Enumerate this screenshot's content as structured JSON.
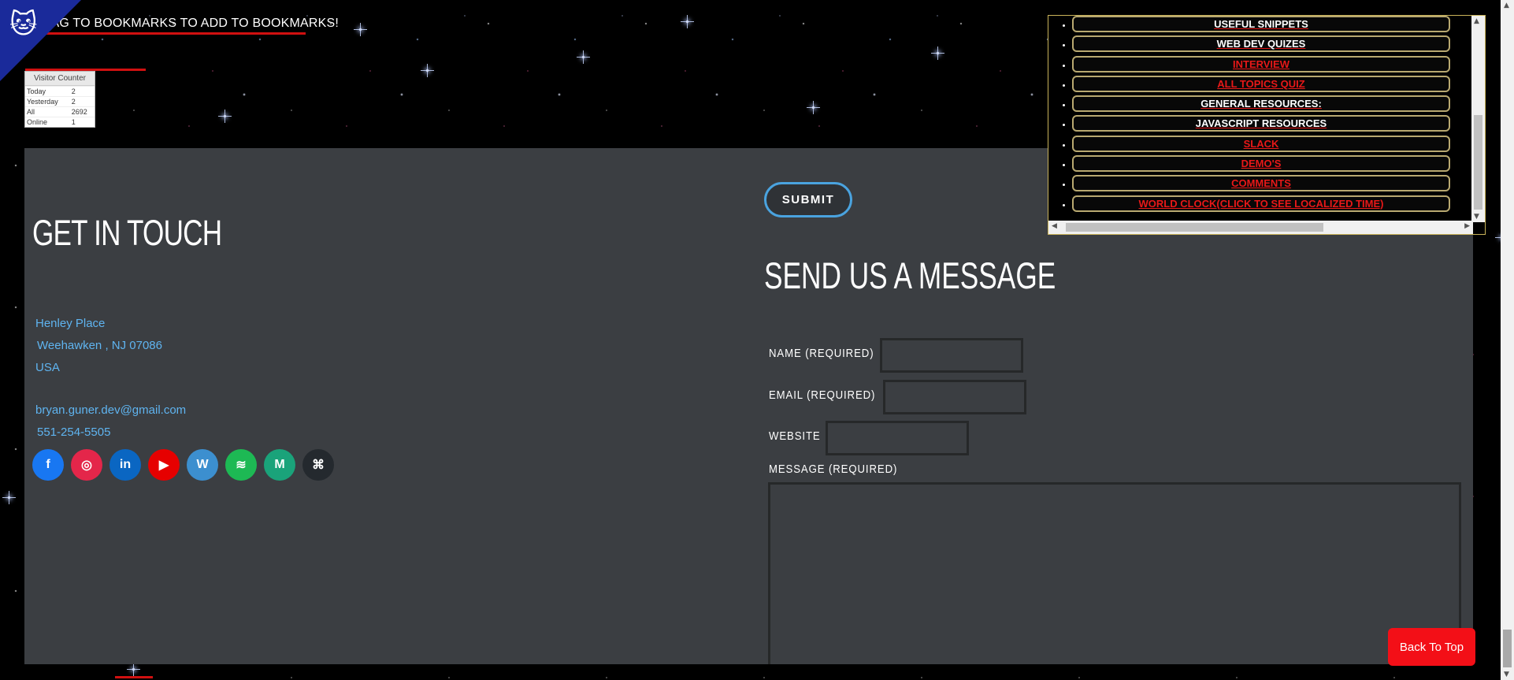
{
  "bookmark_banner": "DRAG TO BOOKMARKS TO ADD TO BOOKMARKS!",
  "visitor_counter": {
    "title": "Visitor Counter",
    "rows": [
      {
        "label": "Today",
        "value": "2"
      },
      {
        "label": "Yesterday",
        "value": "2"
      },
      {
        "label": "All",
        "value": "2692"
      },
      {
        "label": "Online",
        "value": "1"
      }
    ]
  },
  "nav_menu": {
    "items": [
      {
        "label": "USEFUL SNIPPETS",
        "color": "white"
      },
      {
        "label": "WEB DEV QUIZES",
        "color": "white"
      },
      {
        "label": "INTERVIEW",
        "color": "red"
      },
      {
        "label": "ALL TOPICS QUIZ",
        "color": "red"
      },
      {
        "label": "GENERAL RESOURCES:",
        "color": "white"
      },
      {
        "label": "JAVASCRIPT RESOURCES",
        "color": "white"
      },
      {
        "label": "SLACK",
        "color": "red"
      },
      {
        "label": "DEMO'S",
        "color": "red"
      },
      {
        "label": "COMMENTS",
        "color": "red"
      },
      {
        "label": "WORLD CLOCK(CLICK TO SEE LOCALIZED TIME)",
        "color": "red"
      }
    ]
  },
  "contact": {
    "title": "GET IN TOUCH",
    "address_line1": "Henley Place",
    "address_line2": "Weehawken , NJ  07086",
    "country": "USA",
    "email": "bryan.guner.dev@gmail.com",
    "phone": "551-254-5505",
    "socials": [
      {
        "name": "facebook-icon",
        "glyph": "f",
        "color": "#1877f2"
      },
      {
        "name": "instagram-icon",
        "glyph": "◎",
        "color": "#e4264a"
      },
      {
        "name": "linkedin-icon",
        "glyph": "in",
        "color": "#0a66c2"
      },
      {
        "name": "youtube-icon",
        "glyph": "▶",
        "color": "#e60000"
      },
      {
        "name": "wordpress-icon",
        "glyph": "W",
        "color": "#3c8fcf"
      },
      {
        "name": "spotify-icon",
        "glyph": "≋",
        "color": "#1db954"
      },
      {
        "name": "medium-icon",
        "glyph": "M",
        "color": "#1aa37a"
      },
      {
        "name": "github-icon",
        "glyph": "⌘",
        "color": "#24292e"
      }
    ]
  },
  "form": {
    "submit_label": "SUBMIT",
    "title": "SEND US A MESSAGE",
    "name_label": "NAME (REQUIRED)",
    "email_label": "EMAIL (REQUIRED)",
    "website_label": "WEBSITE",
    "message_label": "MESSAGE (REQUIRED)",
    "name_value": "",
    "email_value": "",
    "website_value": "",
    "message_value": ""
  },
  "back_to_top": "Back To Top"
}
